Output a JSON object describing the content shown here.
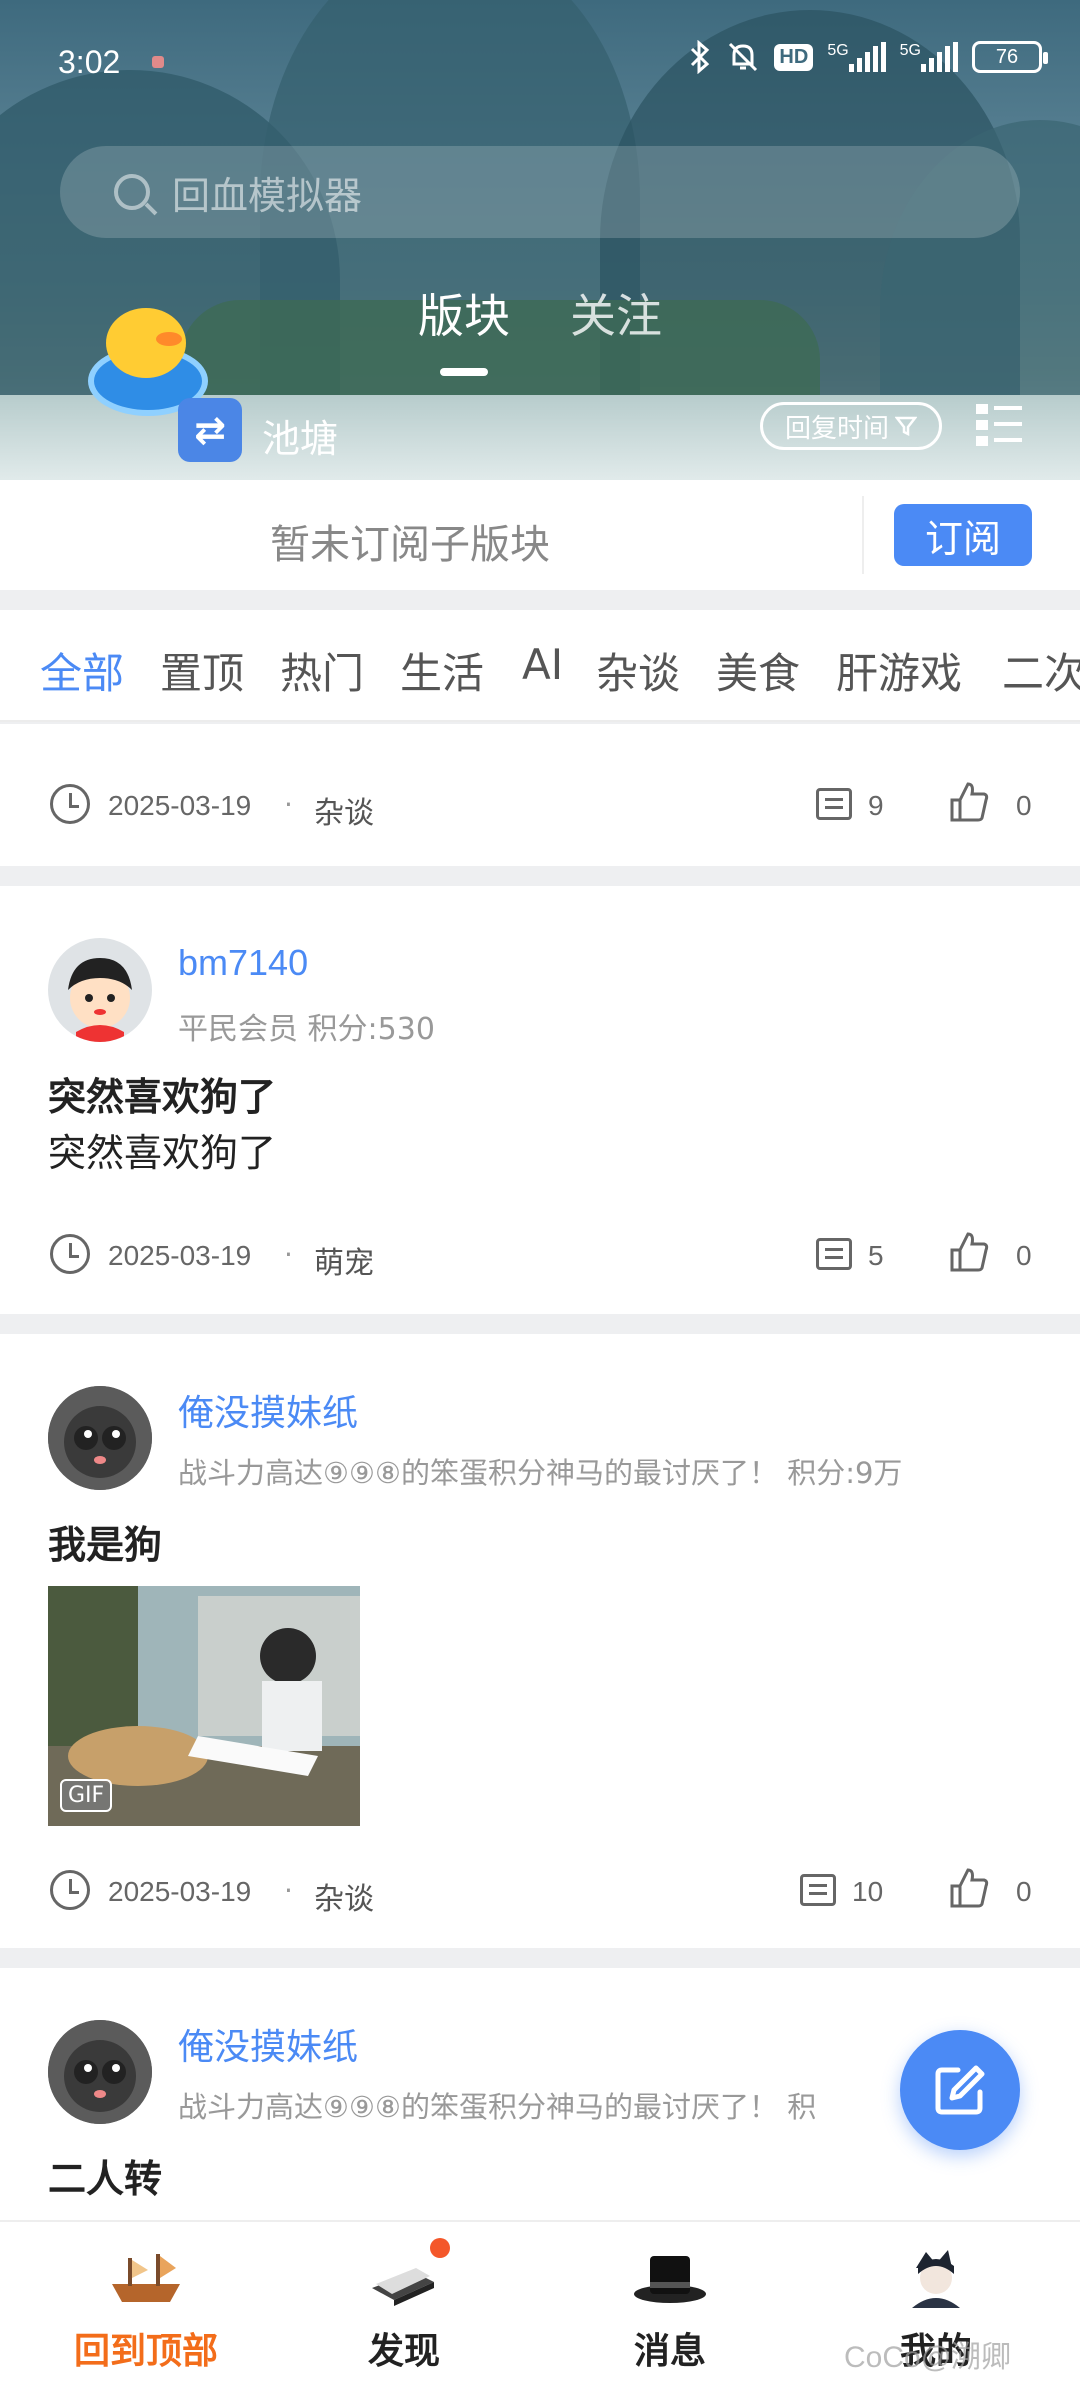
{
  "status_bar": {
    "time": "3:02",
    "hd_label": "HD",
    "net1": "5G",
    "net2": "5G",
    "battery": "76"
  },
  "search": {
    "placeholder": "回血模拟器"
  },
  "tabs": [
    "版块",
    "关注"
  ],
  "board": {
    "name": "池塘",
    "sort_label": "回复时间"
  },
  "subscribe": {
    "text": "暂未订阅子版块",
    "button": "订阅"
  },
  "categories": [
    "全部",
    "置顶",
    "热门",
    "生活",
    "AI",
    "杂谈",
    "美食",
    "肝游戏",
    "二次"
  ],
  "posts": [
    {
      "date": "2025-03-19",
      "tag": "杂谈",
      "comments": "9",
      "likes": "0"
    },
    {
      "user": "bm7140",
      "meta": "平民会员  积分:530",
      "title": "突然喜欢狗了",
      "body": "突然喜欢狗了",
      "date": "2025-03-19",
      "tag": "萌宠",
      "comments": "5",
      "likes": "0"
    },
    {
      "user": "俺没摸妹纸",
      "meta": "战斗力高达⑨⑨⑧的笨蛋积分神马的最讨厌了！  积分:9万",
      "title": "我是狗",
      "gif_label": "GIF",
      "date": "2025-03-19",
      "tag": "杂谈",
      "comments": "10",
      "likes": "0"
    },
    {
      "user": "俺没摸妹纸",
      "meta": "战斗力高达⑨⑨⑧的笨蛋积分神马的最讨厌了！  积",
      "title": "二人转"
    }
  ],
  "nav": [
    "回到顶部",
    "发现",
    "消息",
    "我的"
  ],
  "watermark": "CoCo@溯卿",
  "colors": {
    "accent": "#4b8af5",
    "active_nav": "#f36d1a"
  }
}
